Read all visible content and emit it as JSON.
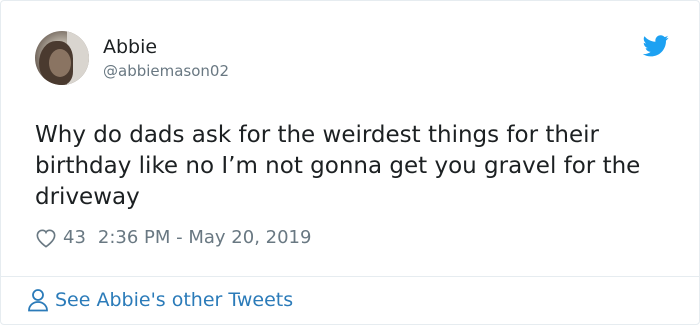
{
  "author": {
    "display_name": "Abbie",
    "handle": "@abbiemason02",
    "avatar_icon": "user-photo"
  },
  "tweet": {
    "text": "Why do dads ask for the weirdest things for their birthday like no I’m not gonna get you gravel for the driveway",
    "likes": "43",
    "timestamp": "2:36 PM - May 20, 2019"
  },
  "footer": {
    "link_label": "See Abbie's other Tweets",
    "icon": "person-outline-icon"
  },
  "colors": {
    "brand_blue": "#1da1f2",
    "link_blue": "#2b7bb9",
    "text": "#1c2022",
    "muted": "#697882",
    "border": "#e6ecf0"
  }
}
